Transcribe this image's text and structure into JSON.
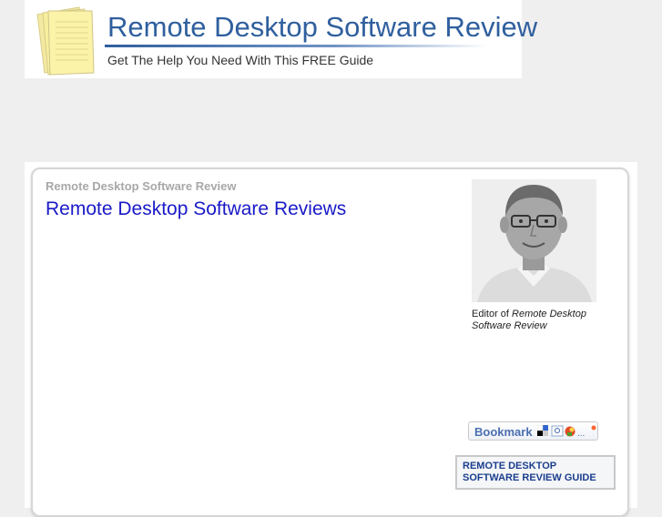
{
  "header": {
    "site_title": "Remote Desktop Software Review",
    "tagline": "Get The Help You Need With This FREE Guide",
    "logo_icon": "document-stack-icon"
  },
  "main": {
    "breadcrumb": "Remote Desktop Software Review",
    "heading": "Remote Desktop Software Reviews"
  },
  "sidebar": {
    "editor_caption_prefix": "Editor of ",
    "editor_caption_italic": "Remote Desktop Software Review",
    "bookmark_label": "Bookmark",
    "bookmark_more": "...",
    "guide_link": "REMOTE DESKTOP SOFTWARE REVIEW GUIDE"
  },
  "colors": {
    "title_blue": "#2f5f9e",
    "heading_blue": "#1a1ac8",
    "page_bg": "#efefef"
  }
}
